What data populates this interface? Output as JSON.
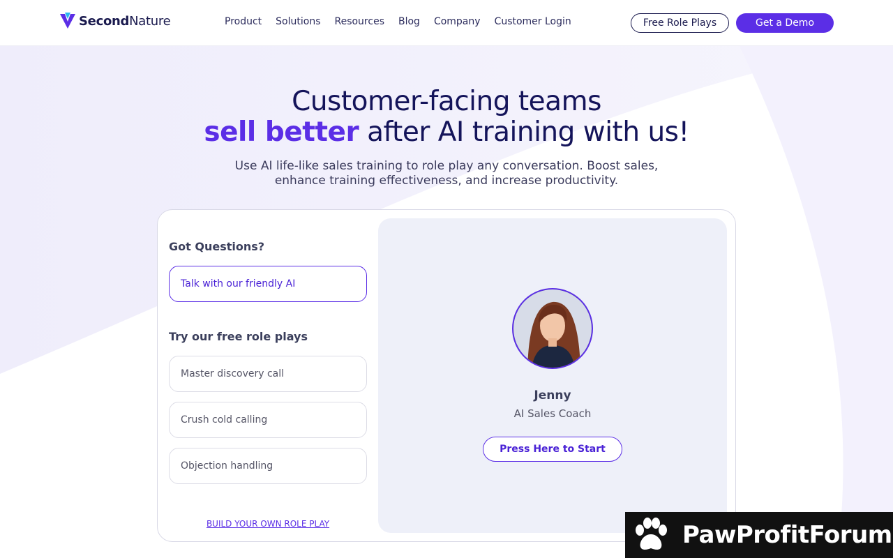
{
  "header": {
    "brand_bold": "Second",
    "brand_light": "Nature",
    "nav": [
      "Product",
      "Solutions",
      "Resources",
      "Blog",
      "Company",
      "Customer Login"
    ],
    "free_btn": "Free Role Plays",
    "demo_btn": "Get a Demo"
  },
  "hero": {
    "line1": "Customer-facing teams",
    "accent": "sell better",
    "line2_rest": " after AI training with us!",
    "subtitle_1": "Use AI life-like sales training to role play any conversation. Boost sales,",
    "subtitle_2": "enhance training effectiveness, and increase productivity."
  },
  "card": {
    "questions_title": "Got Questions?",
    "talk_ai": "Talk with our friendly AI",
    "roleplays_title": "Try our free role plays",
    "options": [
      "Master discovery call",
      "Crush cold calling",
      "Objection handling"
    ],
    "build_link": "BUILD YOUR OWN ROLE PLAY"
  },
  "coach": {
    "name": "Jenny",
    "role": "AI Sales Coach",
    "start_btn": "Press Here to Start"
  },
  "watermark": {
    "text": "PawProfitForum"
  },
  "colors": {
    "accent": "#5b2ee6",
    "navy": "#14145a",
    "panel": "#eef0f9"
  }
}
